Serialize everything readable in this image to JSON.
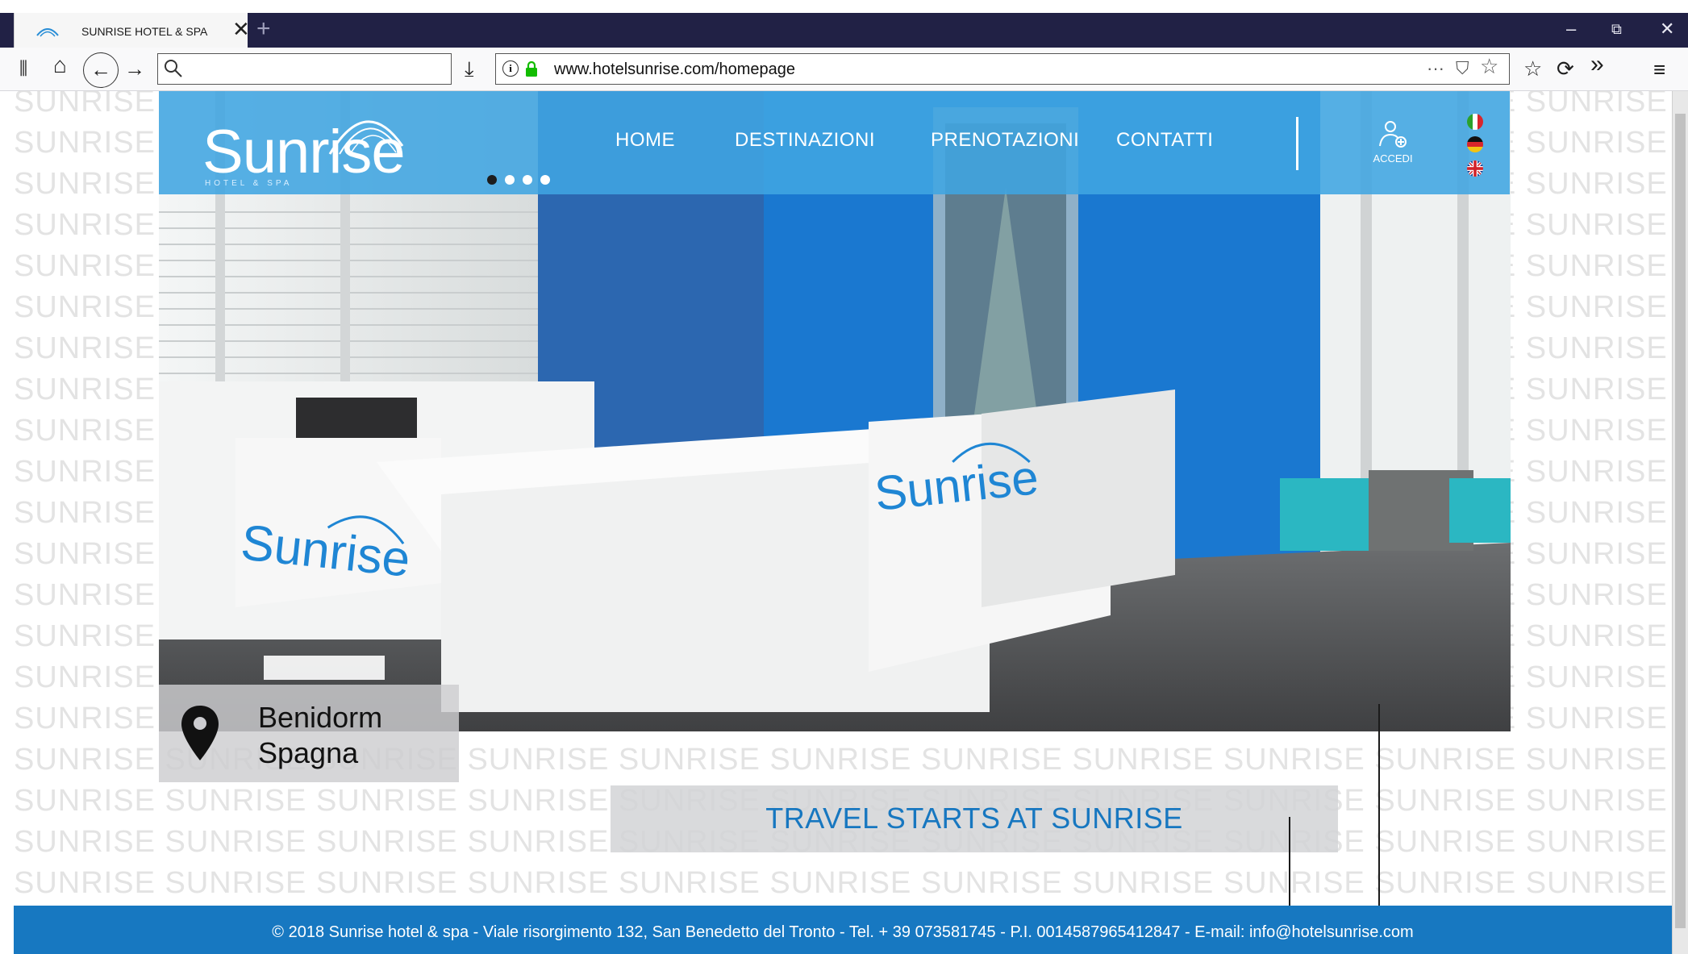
{
  "browser": {
    "tab_title": "SUNRISE HOTEL & SPA",
    "close_glyph": "✕",
    "new_tab_glyph": "+",
    "url": "www.hotelsunrise.com/homepage",
    "search_placeholder": "",
    "window_controls": {
      "minimize": "–",
      "restore": "⧉",
      "close": "✕"
    },
    "toolbar_glyphs": {
      "library": "⫼",
      "home": "⌂",
      "back": "←",
      "forward": "→",
      "download": "⤓",
      "more": "···",
      "pocket": "⛉",
      "star": "☆",
      "bookmarks": "☆",
      "reload": "⟳",
      "overflow": "»",
      "menu": "≡"
    }
  },
  "site": {
    "brand": {
      "name": "Sunrise",
      "subtitle": "HOTEL & SPA"
    },
    "nav": [
      "HOME",
      "DESTINAZIONI",
      "PRENOTAZIONI",
      "CONTATTI"
    ],
    "login_label": "ACCEDI",
    "languages": [
      "it",
      "de",
      "en"
    ],
    "carousel": {
      "count": 4,
      "active": 1
    },
    "watermark_word": "SUNRISE",
    "location": {
      "city": "Benidorm",
      "country": "Spagna"
    },
    "tagline": "TRAVEL STARTS AT SUNRISE",
    "footer": "© 2018 Sunrise hotel & spa - Viale risorgimento 132, San Benedetto del Tronto - Tel. + 39 073581745 - P.I. 0014587965412847 - E-mail: info@hotelsunrise.com"
  },
  "colors": {
    "brand_blue": "#1778c1",
    "nav_blue": "#40a5e1",
    "tagline_blue": "#1777c0",
    "chrome_dark": "#212145"
  }
}
